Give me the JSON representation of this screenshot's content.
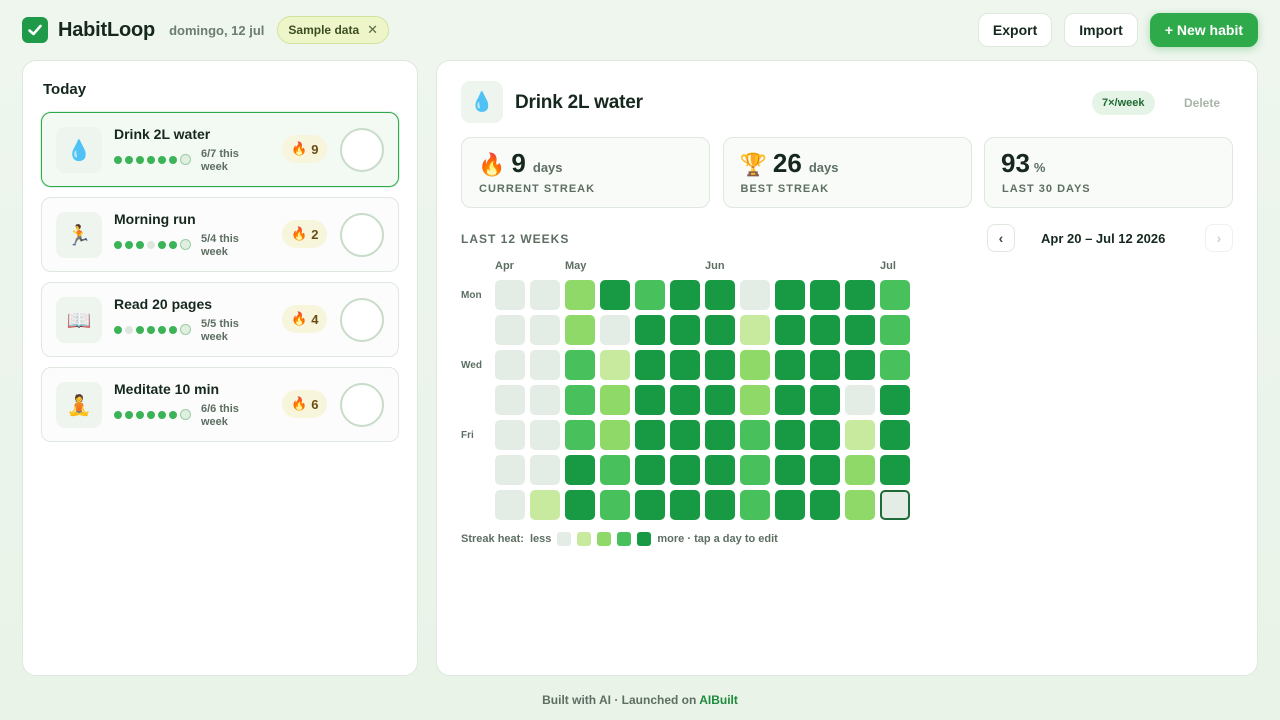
{
  "header": {
    "app_name": "HabitLoop",
    "date": "domingo, 12 jul",
    "sample_chip": "Sample data",
    "export_label": "Export",
    "import_label": "Import",
    "new_habit_label": "+ New habit"
  },
  "today": {
    "title": "Today",
    "habits": [
      {
        "emoji": "💧",
        "name": "Drink 2L water",
        "progress": "6/7 this week",
        "streak": "9",
        "dots": [
          1,
          1,
          1,
          1,
          1,
          1,
          2
        ],
        "active": true
      },
      {
        "emoji": "🏃",
        "name": "Morning run",
        "progress": "5/4 this week",
        "streak": "2",
        "dots": [
          1,
          1,
          1,
          0,
          1,
          1,
          2
        ],
        "active": false
      },
      {
        "emoji": "📖",
        "name": "Read 20 pages",
        "progress": "5/5 this week",
        "streak": "4",
        "dots": [
          1,
          0,
          1,
          1,
          1,
          1,
          2
        ],
        "active": false
      },
      {
        "emoji": "🧘",
        "name": "Meditate 10 min",
        "progress": "6/6 this week",
        "streak": "6",
        "dots": [
          1,
          1,
          1,
          1,
          1,
          1,
          2
        ],
        "active": false
      }
    ]
  },
  "detail": {
    "emoji": "💧",
    "title": "Drink 2L water",
    "frequency": "7×/week",
    "delete_label": "Delete",
    "stats": [
      {
        "icon": "🔥",
        "value": "9",
        "unit": "days",
        "label": "CURRENT STREAK"
      },
      {
        "icon": "🏆",
        "value": "26",
        "unit": "days",
        "label": "BEST STREAK"
      },
      {
        "icon": "",
        "value": "93",
        "unit": "%",
        "label": "LAST 30 DAYS"
      }
    ],
    "weeks_label": "LAST 12 WEEKS",
    "range": "Apr 20 – Jul 12 2026",
    "prev_icon": "‹",
    "next_icon": "›",
    "months": [
      {
        "label": "Apr",
        "col": 0
      },
      {
        "label": "May",
        "col": 2
      },
      {
        "label": "Jun",
        "col": 6
      },
      {
        "label": "Jul",
        "col": 11
      }
    ],
    "day_labels": [
      {
        "label": "Mon",
        "row": 0
      },
      {
        "label": "Wed",
        "row": 2
      },
      {
        "label": "Fri",
        "row": 4
      }
    ],
    "heatmap": [
      [
        0,
        0,
        2,
        4,
        3,
        4,
        4,
        0,
        4,
        4,
        4,
        3
      ],
      [
        0,
        0,
        2,
        0,
        4,
        4,
        4,
        1,
        4,
        4,
        4,
        3
      ],
      [
        0,
        0,
        3,
        1,
        4,
        4,
        4,
        2,
        4,
        4,
        4,
        3
      ],
      [
        0,
        0,
        3,
        2,
        4,
        4,
        4,
        2,
        4,
        4,
        0,
        4
      ],
      [
        0,
        0,
        3,
        2,
        4,
        4,
        4,
        3,
        4,
        4,
        1,
        4
      ],
      [
        0,
        0,
        4,
        3,
        4,
        4,
        4,
        3,
        4,
        4,
        2,
        4
      ],
      [
        0,
        1,
        4,
        3,
        4,
        4,
        4,
        3,
        4,
        4,
        2,
        "t"
      ]
    ],
    "legend": {
      "label": "Streak heat:",
      "less": "less",
      "more": "more · tap a day to edit"
    }
  },
  "footer": {
    "text": "Built with AI · Launched on ",
    "brand": "AIBuilt"
  }
}
